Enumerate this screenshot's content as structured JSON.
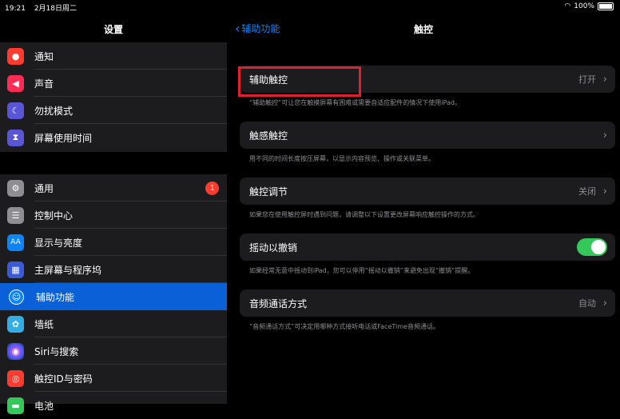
{
  "status_bar": {
    "time": "19:21",
    "date": "2月18日周二",
    "battery": "100%"
  },
  "sidebar": {
    "title": "设置",
    "group1": [
      {
        "label": "通知",
        "icon": "bell-icon",
        "color": "#ff3b30",
        "glyph": "●"
      },
      {
        "label": "声音",
        "icon": "speaker-icon",
        "color": "#ff2d55",
        "glyph": "◀"
      },
      {
        "label": "勿扰模式",
        "icon": "moon-icon",
        "color": "#5856d6",
        "glyph": "☾"
      },
      {
        "label": "屏幕使用时间",
        "icon": "hourglass-icon",
        "color": "#5856d6",
        "glyph": "⧗"
      }
    ],
    "group2": [
      {
        "label": "通用",
        "icon": "gear-icon",
        "color": "#8e8e93",
        "glyph": "⚙",
        "badge": "1"
      },
      {
        "label": "控制中心",
        "icon": "switches-icon",
        "color": "#8e8e93",
        "glyph": "☰"
      },
      {
        "label": "显示与亮度",
        "icon": "text-size-icon",
        "color": "#0a84ff",
        "glyph": "AA"
      },
      {
        "label": "主屏幕与程序坞",
        "icon": "grid-icon",
        "color": "#3a5bd9",
        "glyph": "▦"
      },
      {
        "label": "辅助功能",
        "icon": "accessibility-icon",
        "color": "#0a84ff",
        "glyph": "☺",
        "selected": true
      },
      {
        "label": "墙纸",
        "icon": "flower-icon",
        "color": "#32ade6",
        "glyph": "✿"
      },
      {
        "label": "Siri与搜索",
        "icon": "siri-icon",
        "color": "#222222",
        "glyph": "◉"
      },
      {
        "label": "触控ID与密码",
        "icon": "fingerprint-icon",
        "color": "#ff3b30",
        "glyph": "◎"
      },
      {
        "label": "电池",
        "icon": "battery-icon",
        "color": "#34c759",
        "glyph": "▬"
      }
    ]
  },
  "detail": {
    "back_label": "辅助功能",
    "title": "触控",
    "rows": [
      {
        "label": "辅助触控",
        "value": "打开",
        "footer": "“辅助触控”可让您在触摸屏幕有困难或需要自适应配件的情况下使用iPad。"
      },
      {
        "label": "触感触控",
        "value": "",
        "footer": "用不同的时间长度按压屏幕，以显示内容预览、操作或关联菜单。"
      },
      {
        "label": "触控调节",
        "value": "关闭",
        "footer": "如果您在使用触控屏时遇到问题，请调整以下设置更改屏幕响应触控操作的方式。"
      },
      {
        "label": "摇动以撤销",
        "toggle": true,
        "footer": "如果经常无意中摇动到iPad，您可以停用“摇动以撤销”来避免出现“撤销”提醒。"
      },
      {
        "label": "音频通话方式",
        "value": "自动",
        "footer": "“音频通话方式”可决定用哪种方式接听电话或FaceTime音频通话。"
      }
    ]
  },
  "highlight_color": "#e0202e"
}
